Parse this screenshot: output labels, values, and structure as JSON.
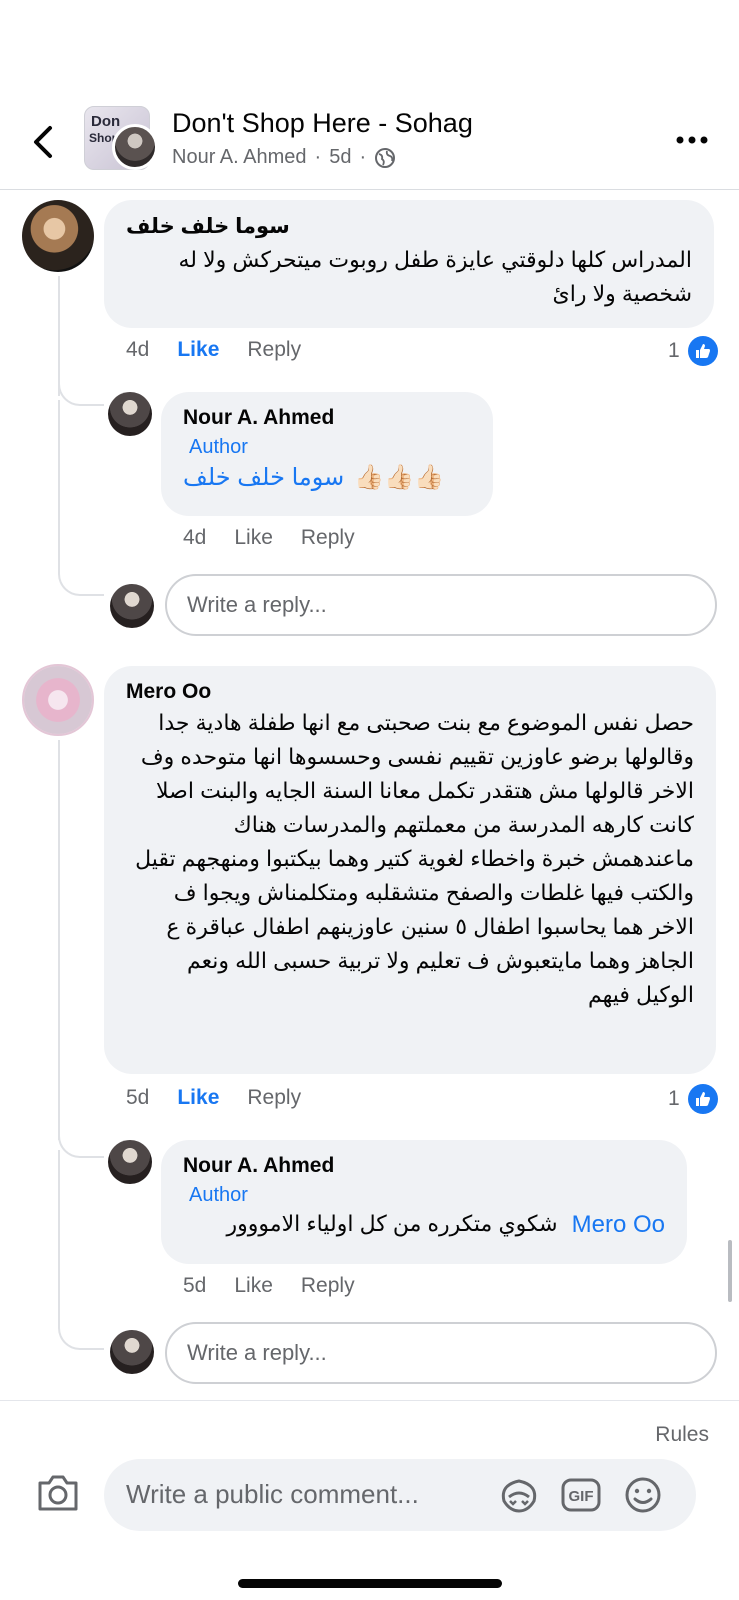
{
  "header": {
    "group_name": "Don't Shop Here - Sohag",
    "poster_name": "Nour A. Ahmed",
    "time": "5d",
    "thumb_line1": "Don",
    "thumb_line2": "Shop",
    "icons": [
      "back-chevron-icon",
      "globe-icon",
      "more-icon"
    ]
  },
  "comments": [
    {
      "author": "سوما خلف خلف",
      "text": "المدراس كلها دلوقتي عايزة طفل روبوت ميتحركش ولا له شخصية ولا رائ",
      "time": "4d",
      "like": "Like",
      "reply": "Reply",
      "reactions": "1",
      "replies": [
        {
          "author": "Nour A. Ahmed",
          "badge": "Author",
          "mention": "سوما خلف خلف",
          "emoji": "👍🏻👍🏻👍🏻",
          "time": "4d",
          "like": "Like",
          "reply": "Reply"
        }
      ],
      "reply_placeholder": "Write a reply..."
    },
    {
      "author": "Mero Oo",
      "text": "حصل نفس الموضوع مع بنت صحبتى مع انها طفلة هادية جدا وقالولها برضو عاوزين تقييم نفسى وحسسوها انها متوحده وف الاخر قالولها مش هتقدر تكمل معانا السنة الجايه والبنت اصلا كانت كارهه المدرسة من معملتهم والمدرسات هناك ماعندهمش خبرة واخطاء لغوية كتير وهما بيكتبوا ومنهجهم تقيل والكتب فيها غلطات والصفح متشقلبه ومتكلمناش ويجوا ف الاخر هما يحاسبوا اطفال ٥ سنين عاوزينهم اطفال عباقرة ع الجاهز وهما مايتعبوش ف تعليم ولا تربية حسبى الله ونعم الوكيل فيهم",
      "time": "5d",
      "like": "Like",
      "reply": "Reply",
      "reactions": "1",
      "replies": [
        {
          "author": "Nour A. Ahmed",
          "badge": "Author",
          "mention": "Mero Oo",
          "text": "شكوي متكرره من كل اولياء الامووور",
          "time": "5d",
          "like": "Like",
          "reply": "Reply"
        }
      ],
      "reply_placeholder": "Write a reply..."
    }
  ],
  "footer": {
    "rules": "Rules",
    "composer_placeholder": "Write a public comment...",
    "gif_label": "GIF",
    "icons": [
      "camera-icon",
      "avatar-sticker-icon",
      "gif-icon",
      "emoji-icon"
    ]
  },
  "colors": {
    "accent": "#1877f2",
    "bubble": "#f0f2f5",
    "secondary_text": "#65676b"
  }
}
